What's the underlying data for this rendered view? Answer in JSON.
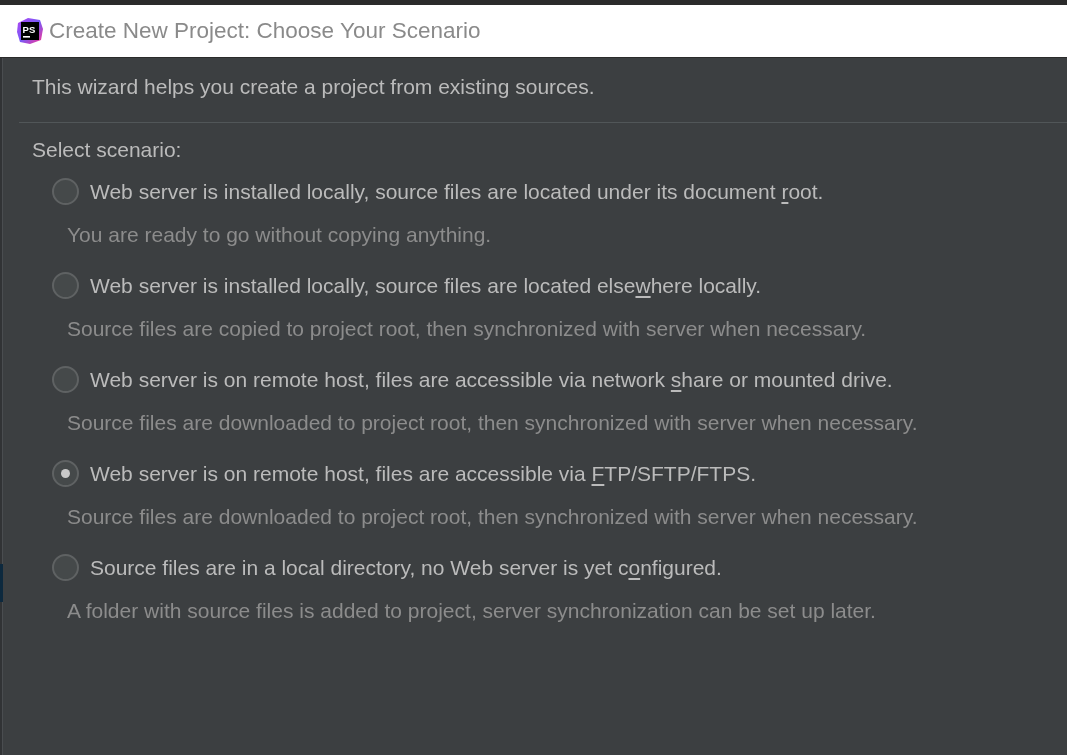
{
  "window": {
    "title": "Create New Project: Choose Your Scenario",
    "logo_text": "PS"
  },
  "intro": "This wizard helps you create a project from existing sources.",
  "scenario_heading": "Select scenario:",
  "scenarios": [
    {
      "label": {
        "before": "Web server is installed locally, source files are located under its document ",
        "mnemonic": "r",
        "after": "oot."
      },
      "description": "You are ready to go without copying anything.",
      "selected": false
    },
    {
      "label": {
        "before": "Web server is installed locally, source files are located else",
        "mnemonic": "w",
        "after": "here locally."
      },
      "description": "Source files are copied to project root, then synchronized with server when necessary.",
      "selected": false
    },
    {
      "label": {
        "before": "Web server is on remote host, files are accessible via network ",
        "mnemonic": "s",
        "after": "hare or mounted drive."
      },
      "description": "Source files are downloaded to project root, then synchronized with server when necessary.",
      "selected": false
    },
    {
      "label": {
        "before": "Web server is on remote host, files are accessible via ",
        "mnemonic": "F",
        "after": "TP/SFTP/FTPS."
      },
      "description": "Source files are downloaded to project root, then synchronized with server when necessary.",
      "selected": true
    },
    {
      "label": {
        "before": "Source files are in a local directory, no Web server is yet c",
        "mnemonic": "o",
        "after": "nfigured."
      },
      "description": "A folder with source files is added to project, server synchronization can be set up later.",
      "selected": false
    }
  ]
}
